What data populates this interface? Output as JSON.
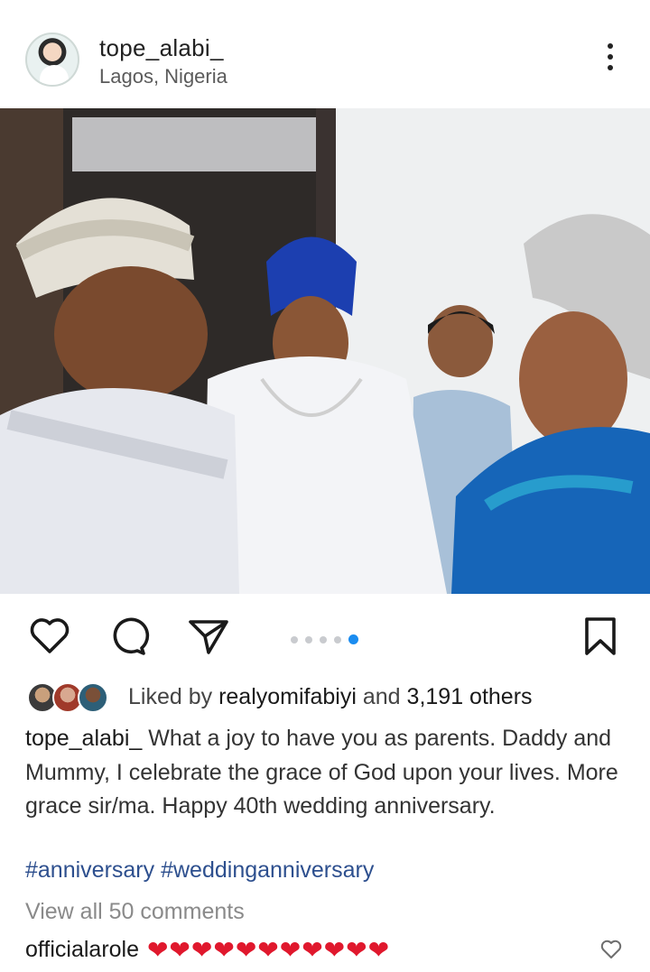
{
  "post": {
    "username": "tope_alabi_",
    "location": "Lagos, Nigeria"
  },
  "carousel": {
    "count": 5,
    "active_index": 4
  },
  "icons": {
    "more": "more-options-icon",
    "like": "heart-icon",
    "comment": "comment-bubble-icon",
    "share": "send-paper-plane-icon",
    "save": "bookmark-icon"
  },
  "likes": {
    "prefix": "Liked by",
    "liker": "realyomifabiyi",
    "conjunction": "and",
    "others": "3,191 others"
  },
  "caption": {
    "username": "tope_alabi_",
    "text": "What a joy to have you as parents. Daddy and Mummy, I celebrate the grace of God upon your lives. More grace sir/ma. Happy 40th wedding anniversary.",
    "hashtags": [
      "#anniversary",
      "#weddinganniversary"
    ]
  },
  "comments": {
    "view_all": "View all 50 comments",
    "top": {
      "username": "officialarole",
      "emoji": "❤❤❤❤❤❤❤❤❤❤❤"
    }
  },
  "colors": {
    "accent_dot": "#1a8cf0",
    "heart": "#e0182d",
    "hashtag": "#2d4f8e"
  }
}
